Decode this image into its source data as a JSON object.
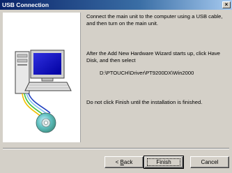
{
  "window": {
    "title": "USB Connection",
    "close_label": "×"
  },
  "content": {
    "paragraph1": "Connect the main unit to the computer using a USB cable, and then turn on the main unit.",
    "paragraph2": "After the Add New Hardware Wizard starts up, click Have Disk, and then select",
    "path": "D:\\PTOUCH\\Driver\\PT9200DX\\Win2000",
    "paragraph3": "Do not click Finish until the installation is finished."
  },
  "buttons": {
    "back_prefix": "< ",
    "back_accel": "B",
    "back_rest": "ack",
    "finish": "Finish",
    "cancel": "Cancel"
  },
  "icons": {
    "computer": "computer-icon",
    "cd": "cd-disc-icon",
    "cable": "usb-cable-icon"
  }
}
